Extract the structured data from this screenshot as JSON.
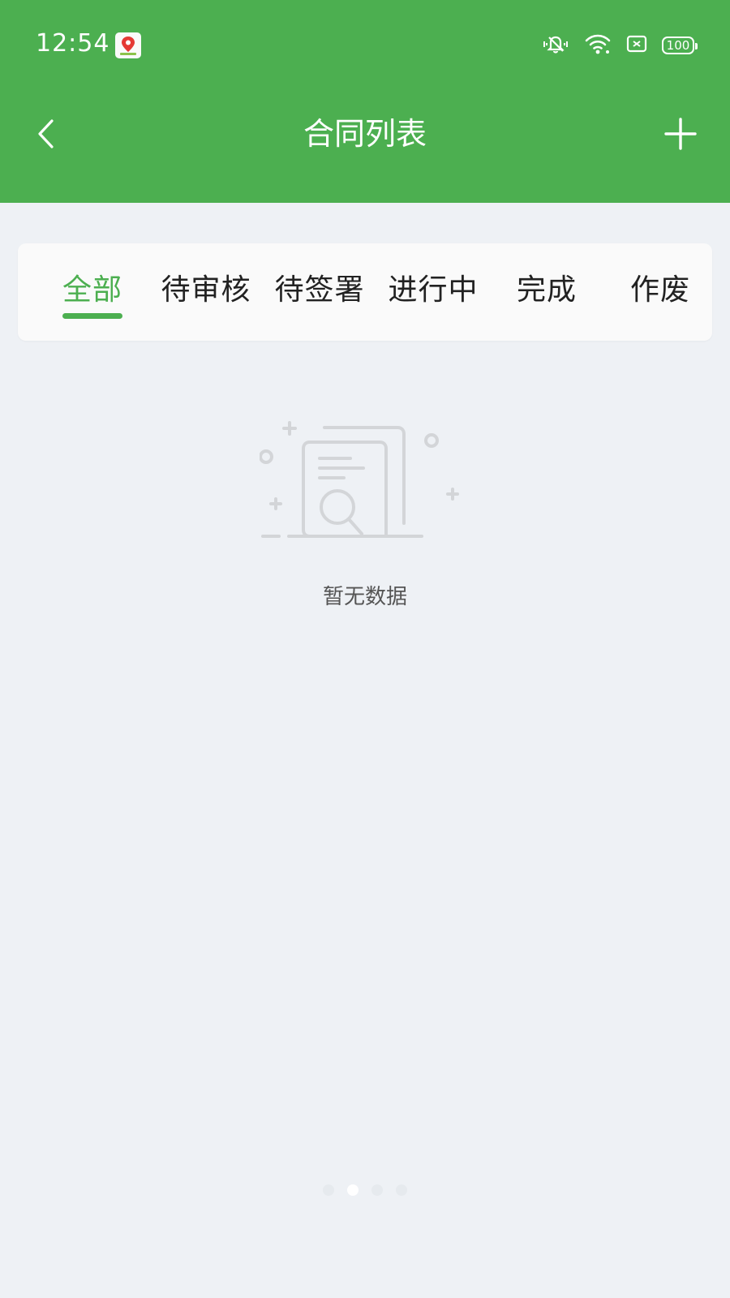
{
  "status_bar": {
    "time": "12:54",
    "battery": "100",
    "icons": [
      "app-notification-icon",
      "vibrate-icon",
      "wifi-icon",
      "sim-icon",
      "battery-icon"
    ]
  },
  "nav": {
    "title": "合同列表",
    "back_icon": "back-chevron-icon",
    "add_icon": "plus-icon"
  },
  "tabs": [
    {
      "label": "全部",
      "active": true
    },
    {
      "label": "待审核",
      "active": false
    },
    {
      "label": "待签署",
      "active": false
    },
    {
      "label": "进行中",
      "active": false
    },
    {
      "label": "完成",
      "active": false
    },
    {
      "label": "作废",
      "active": false
    }
  ],
  "empty_state": {
    "text": "暂无数据",
    "icon": "empty-document-search-icon"
  },
  "page_indicator": {
    "count": 4,
    "active_index": 1
  },
  "colors": {
    "primary": "#4caf50",
    "background": "#eef1f5",
    "card": "#fafafa",
    "text": "#222222",
    "muted": "#555555"
  }
}
